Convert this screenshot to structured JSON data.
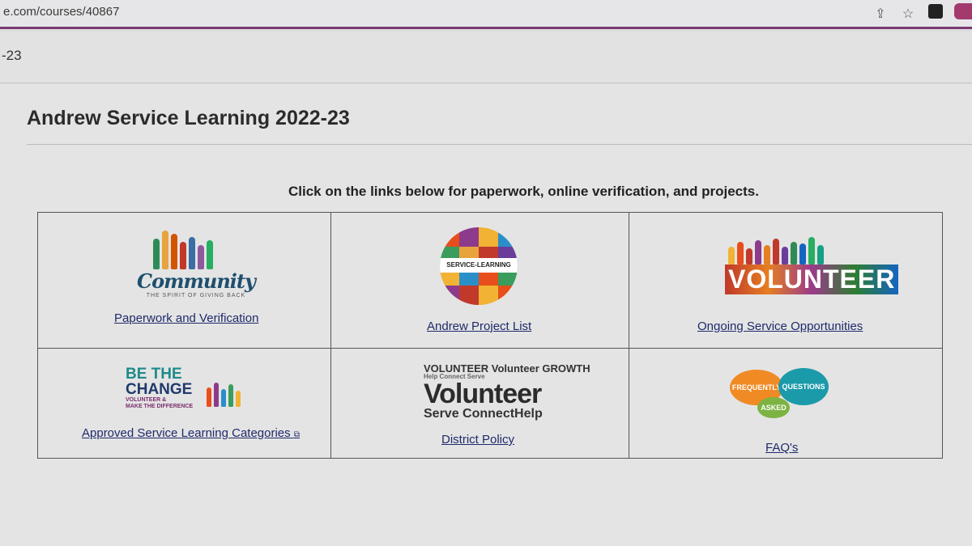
{
  "browser": {
    "url": "e.com/courses/40867",
    "icons": [
      "share-icon",
      "star-icon",
      "extension-icon",
      "extension-icon"
    ]
  },
  "course_bar": {
    "crumb": "-23"
  },
  "page": {
    "title": "Andrew Service Learning 2022-23",
    "intro": "Click on the links below for paperwork, online verification, and projects."
  },
  "cells": [
    {
      "link": "Paperwork and Verification",
      "art": {
        "word": "Community",
        "sub": "THE SPIRIT OF GIVING BACK"
      }
    },
    {
      "link": "Andrew Project List",
      "art": {
        "band": "SERVICE-LEARNING"
      }
    },
    {
      "link": "Ongoing Service Opportunities",
      "art": {
        "word": "VOLUNTEER"
      }
    },
    {
      "link": "Approved Service Learning Categories",
      "external": true,
      "art": {
        "line1": "BE THE",
        "line2": "CHANGE",
        "sub1": "VOLUNTEER &",
        "sub2": "MAKE THE DIFFERENCE"
      }
    },
    {
      "link": "District Policy",
      "art": {
        "words": [
          "VOLUNTEER Volunteer GROWTH",
          "Help Connect Serve",
          "Volunteer",
          "Serve ConnectHelp"
        ]
      }
    },
    {
      "link": "FAQ's",
      "art": {
        "b1": "FREQUENTLY",
        "b2": "QUESTIONS",
        "b3": "ASKED"
      }
    }
  ],
  "colors": {
    "link": "#1f2a6b",
    "accent": "#7b3a6f"
  }
}
